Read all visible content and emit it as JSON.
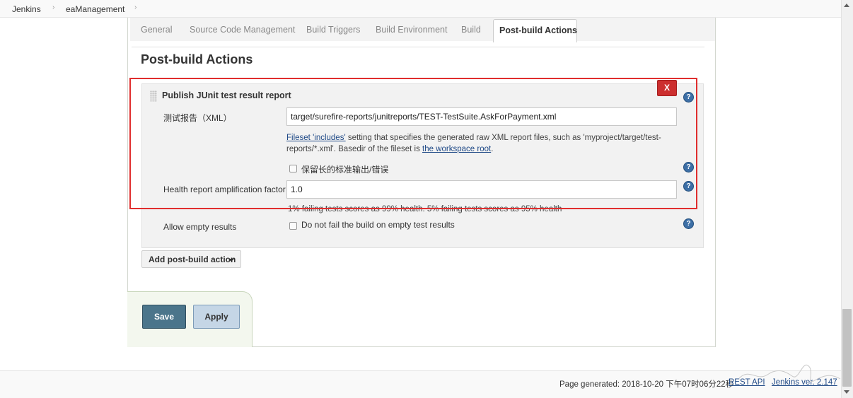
{
  "breadcrumb": {
    "items": [
      "Jenkins",
      "eaManagement"
    ],
    "separator": "›"
  },
  "tabs": [
    {
      "label": "General",
      "active": false
    },
    {
      "label": "Source Code Management",
      "active": false
    },
    {
      "label": "Build Triggers",
      "active": false
    },
    {
      "label": "Build Environment",
      "active": false
    },
    {
      "label": "Build",
      "active": false
    },
    {
      "label": "Post-build Actions",
      "active": true
    }
  ],
  "section_title": "Post-build Actions",
  "publisher": {
    "title": "Publish JUnit test result report",
    "delete_label": "X",
    "report_label": "测试报告（XML）",
    "report_value": "target/surefire-reports/junitreports/TEST-TestSuite.AskForPayment.xml",
    "report_desc_link1": "Fileset 'includes'",
    "report_desc_text1": " setting that specifies the generated raw XML report files, such as 'myproject/target/test-reports/*.xml'. Basedir of the fileset is ",
    "report_desc_link2": "the workspace root",
    "report_desc_text2": ".",
    "retain_label": "保留长的标准输出/错误",
    "health_label": "Health report amplification factor",
    "health_value": "1.0",
    "health_desc": "1% failing tests scores as 99% health. 5% failing tests scores as 95% health",
    "allow_empty_label": "Allow empty results",
    "allow_empty_check": "Do not fail the build on empty test results"
  },
  "help_glyph": "?",
  "add_action_label": "Add post-build action",
  "buttons": {
    "save": "Save",
    "apply": "Apply"
  },
  "footer": {
    "page_generated": "Page generated: 2018-10-20 下午07时06分22秒",
    "rest_api": "REST API",
    "version": "Jenkins ver. 2.147"
  },
  "colors": {
    "highlight": "#e02e2e",
    "delete": "#cc2f2f",
    "save": "#4b758b",
    "apply": "#c5d6e6",
    "link": "#204a87"
  }
}
